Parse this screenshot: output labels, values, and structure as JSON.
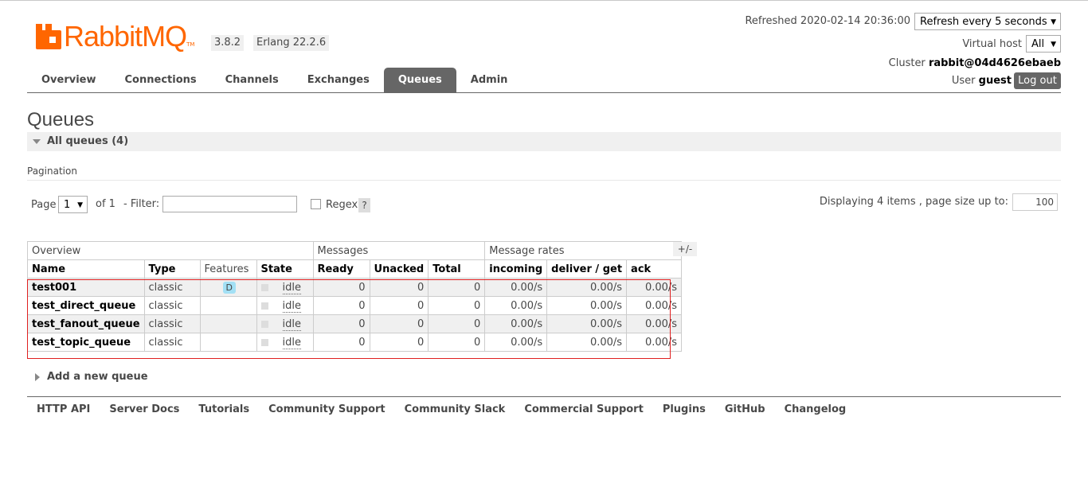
{
  "logo": {
    "text": "RabbitMQ",
    "tm": "TM",
    "color": "#ff6600"
  },
  "versions": {
    "rabbitmq": "3.8.2",
    "erlang": "Erlang 22.2.6"
  },
  "header": {
    "refreshed": "Refreshed 2020-02-14 20:36:00",
    "refresh_select": "Refresh every 5 seconds",
    "vhost_label": "Virtual host",
    "vhost_select": "All",
    "cluster_label": "Cluster",
    "cluster_name": "rabbit@04d4626ebaeb",
    "user_label": "User",
    "user_name": "guest",
    "logout": "Log out"
  },
  "nav": [
    "Overview",
    "Connections",
    "Channels",
    "Exchanges",
    "Queues",
    "Admin"
  ],
  "nav_active": "Queues",
  "page_title": "Queues",
  "section_label": "All queues (4)",
  "pagination": {
    "label": "Pagination",
    "page_label": "Page",
    "page_value": "1",
    "of_label": "of 1",
    "filter_label": "- Filter:",
    "filter_value": "",
    "regex_label": "Regex",
    "help": "?",
    "display_label": "Displaying 4 items , page size up to:",
    "page_size": "100"
  },
  "table": {
    "groups": [
      "Overview",
      "Messages",
      "Message rates"
    ],
    "plusminus": "+/-",
    "columns": [
      "Name",
      "Type",
      "Features",
      "State",
      "Ready",
      "Unacked",
      "Total",
      "incoming",
      "deliver / get",
      "ack"
    ],
    "rows": [
      {
        "name": "test001",
        "type": "classic",
        "features": "D",
        "state": "idle",
        "ready": "0",
        "unacked": "0",
        "total": "0",
        "incoming": "0.00/s",
        "deliver": "0.00/s",
        "ack": "0.00/s"
      },
      {
        "name": "test_direct_queue",
        "type": "classic",
        "features": "",
        "state": "idle",
        "ready": "0",
        "unacked": "0",
        "total": "0",
        "incoming": "0.00/s",
        "deliver": "0.00/s",
        "ack": "0.00/s"
      },
      {
        "name": "test_fanout_queue",
        "type": "classic",
        "features": "",
        "state": "idle",
        "ready": "0",
        "unacked": "0",
        "total": "0",
        "incoming": "0.00/s",
        "deliver": "0.00/s",
        "ack": "0.00/s"
      },
      {
        "name": "test_topic_queue",
        "type": "classic",
        "features": "",
        "state": "idle",
        "ready": "0",
        "unacked": "0",
        "total": "0",
        "incoming": "0.00/s",
        "deliver": "0.00/s",
        "ack": "0.00/s"
      }
    ]
  },
  "add_queue": "Add a new queue",
  "footer": [
    "HTTP API",
    "Server Docs",
    "Tutorials",
    "Community Support",
    "Community Slack",
    "Commercial Support",
    "Plugins",
    "GitHub",
    "Changelog"
  ]
}
